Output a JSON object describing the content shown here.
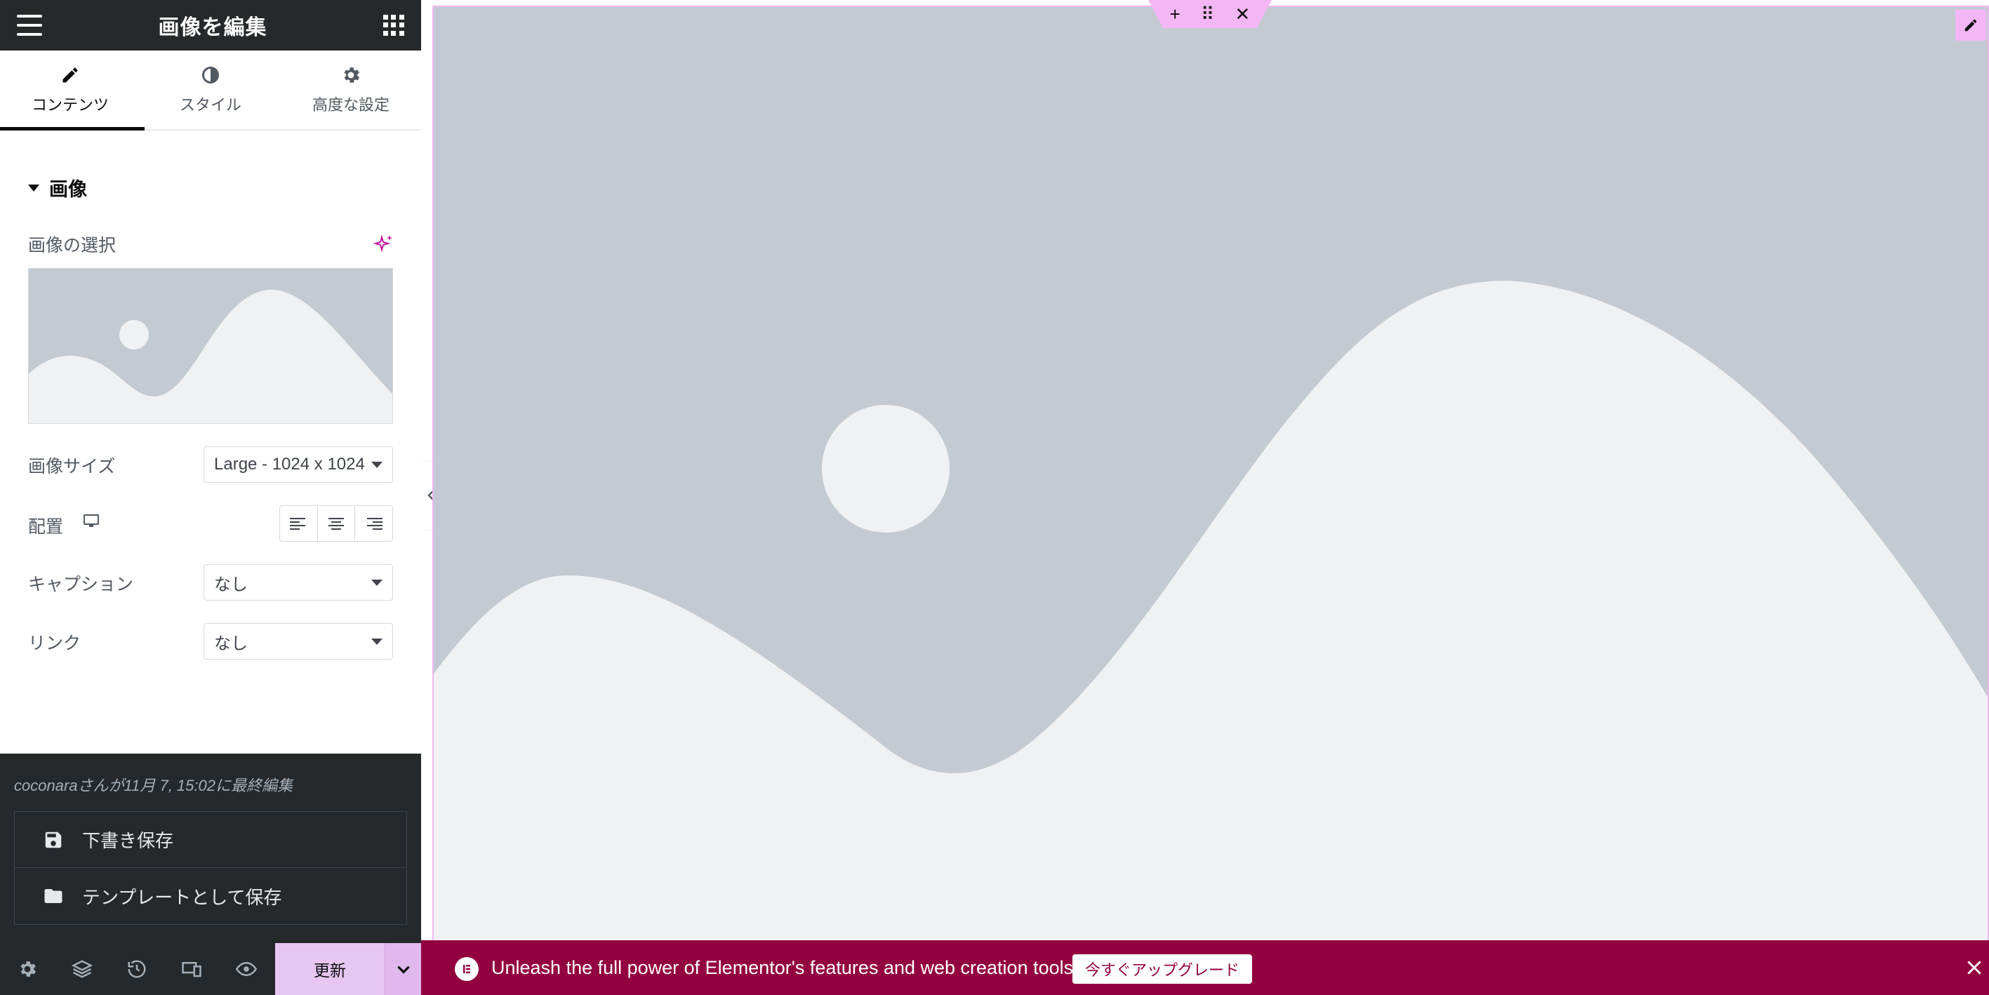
{
  "panel": {
    "title": "画像を編集",
    "tabs": [
      {
        "label": "コンテンツ",
        "icon": "pencil-icon",
        "active": true
      },
      {
        "label": "スタイル",
        "icon": "contrast-icon",
        "active": false
      },
      {
        "label": "高度な設定",
        "icon": "gear-icon",
        "active": false
      }
    ],
    "section_title": "画像",
    "image_select_label": "画像の選択",
    "image_size_label": "画像サイズ",
    "image_size_value": "Large - 1024 x 1024",
    "alignment_label": "配置",
    "caption_label": "キャプション",
    "caption_value": "なし",
    "link_label": "リンク",
    "link_value": "なし"
  },
  "drawer": {
    "last_edit": "coconaraさんが11月 7, 15:02に最終編集",
    "save_draft": "下書き保存",
    "save_template": "テンプレートとして保存"
  },
  "footer": {
    "update_label": "更新"
  },
  "promo": {
    "text": "Unleash the full power of Elementor's features and web creation tools.",
    "upgrade_label": "今すぐアップグレード"
  },
  "colors": {
    "accent_pink": "#f4b6f5",
    "promo_bg": "#93003f",
    "panel_dark": "#26292c",
    "placeholder_gray": "#c4cad1"
  }
}
